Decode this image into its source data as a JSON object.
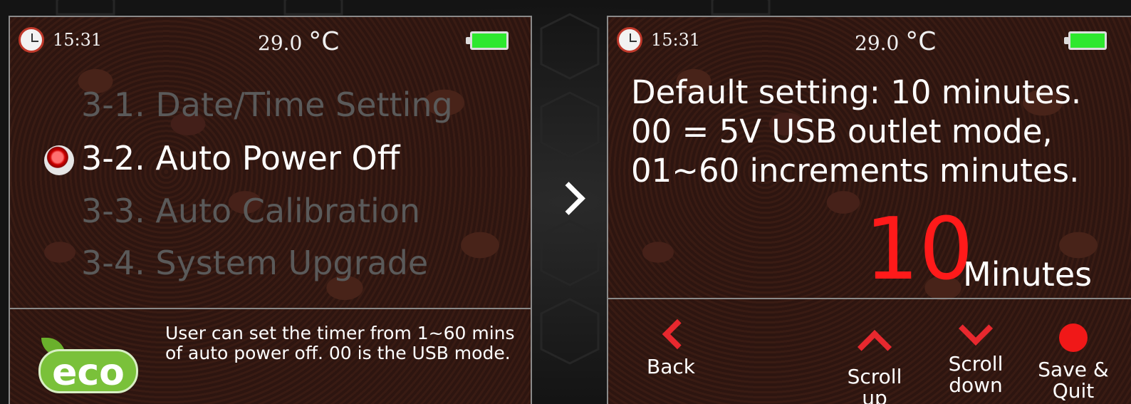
{
  "status": {
    "time": "15:31",
    "temperature": "29.0",
    "temp_unit": "°C",
    "battery": "full"
  },
  "left_screen": {
    "menu": [
      {
        "label": "3-1. Date/Time Setting",
        "selected": false
      },
      {
        "label": "3-2. Auto Power Off",
        "selected": true
      },
      {
        "label": "3-3. Auto Calibration",
        "selected": false
      },
      {
        "label": "3-4. System Upgrade",
        "selected": false
      }
    ],
    "eco_label": "eco",
    "note": "User can set the timer from 1~60 mins of auto power off. 00 is the USB mode."
  },
  "right_screen": {
    "description": [
      "Default setting: 10 minutes.",
      "00 = 5V USB outlet mode,",
      "01~60 increments minutes."
    ],
    "value": "10",
    "unit": "Minutes",
    "buttons": {
      "back": "Back",
      "scroll_up": [
        "Scroll",
        "up"
      ],
      "scroll_down": [
        "Scroll",
        "down"
      ],
      "save_quit": [
        "Save &",
        "Quit"
      ]
    }
  },
  "colors": {
    "highlight": "#ff1a1a",
    "menu_inactive": "#5a5a5a",
    "battery": "#2ee82e"
  },
  "icons": [
    "clock-icon",
    "battery-icon",
    "radio-selected-icon",
    "eco-icon",
    "chevron-right-icon",
    "back-icon",
    "chevron-up-icon",
    "chevron-down-icon",
    "save-dot-icon"
  ]
}
